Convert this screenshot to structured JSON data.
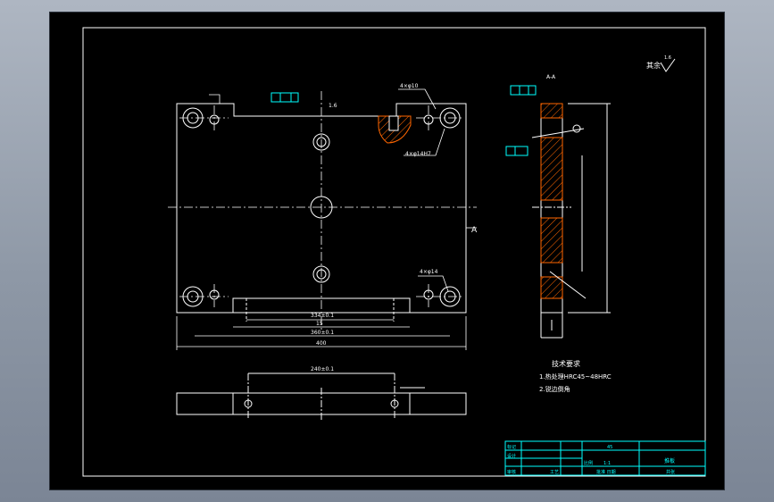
{
  "viewport": {
    "background": "#000000",
    "line_color": "#ffffff",
    "accent_color": "#00ffff",
    "hatch_color": "#ff6600"
  },
  "labels": {
    "surface_roughness_note": "其余",
    "roughness_mark": "1.6",
    "section_mark": "A",
    "dim_width_total": "400",
    "dim_inner_1": "360±0.1",
    "dim_inner_2": "334±0.1",
    "dim_inner_3": "15",
    "dim_bottom_view": "240±0.1",
    "hole_note_1": "4×φ10",
    "hole_note_2": "4×φ14H7",
    "hole_note_3": "4×φ14",
    "side_top_note": "A-A"
  },
  "notes": {
    "title": "技术要求",
    "line1": "1.热处理HRC45~48HRC",
    "line2": "2.锐边倒角"
  },
  "title_block": {
    "cell_tag": "标记",
    "cell_design": "设计",
    "cell_check": "审核",
    "cell_scale": "比例",
    "scale_value": "1:1",
    "cell_material": "45",
    "drawing_name": "推板",
    "cell_process": "工艺",
    "cell_date": "批准  日期",
    "cell_sheet": "共张"
  }
}
